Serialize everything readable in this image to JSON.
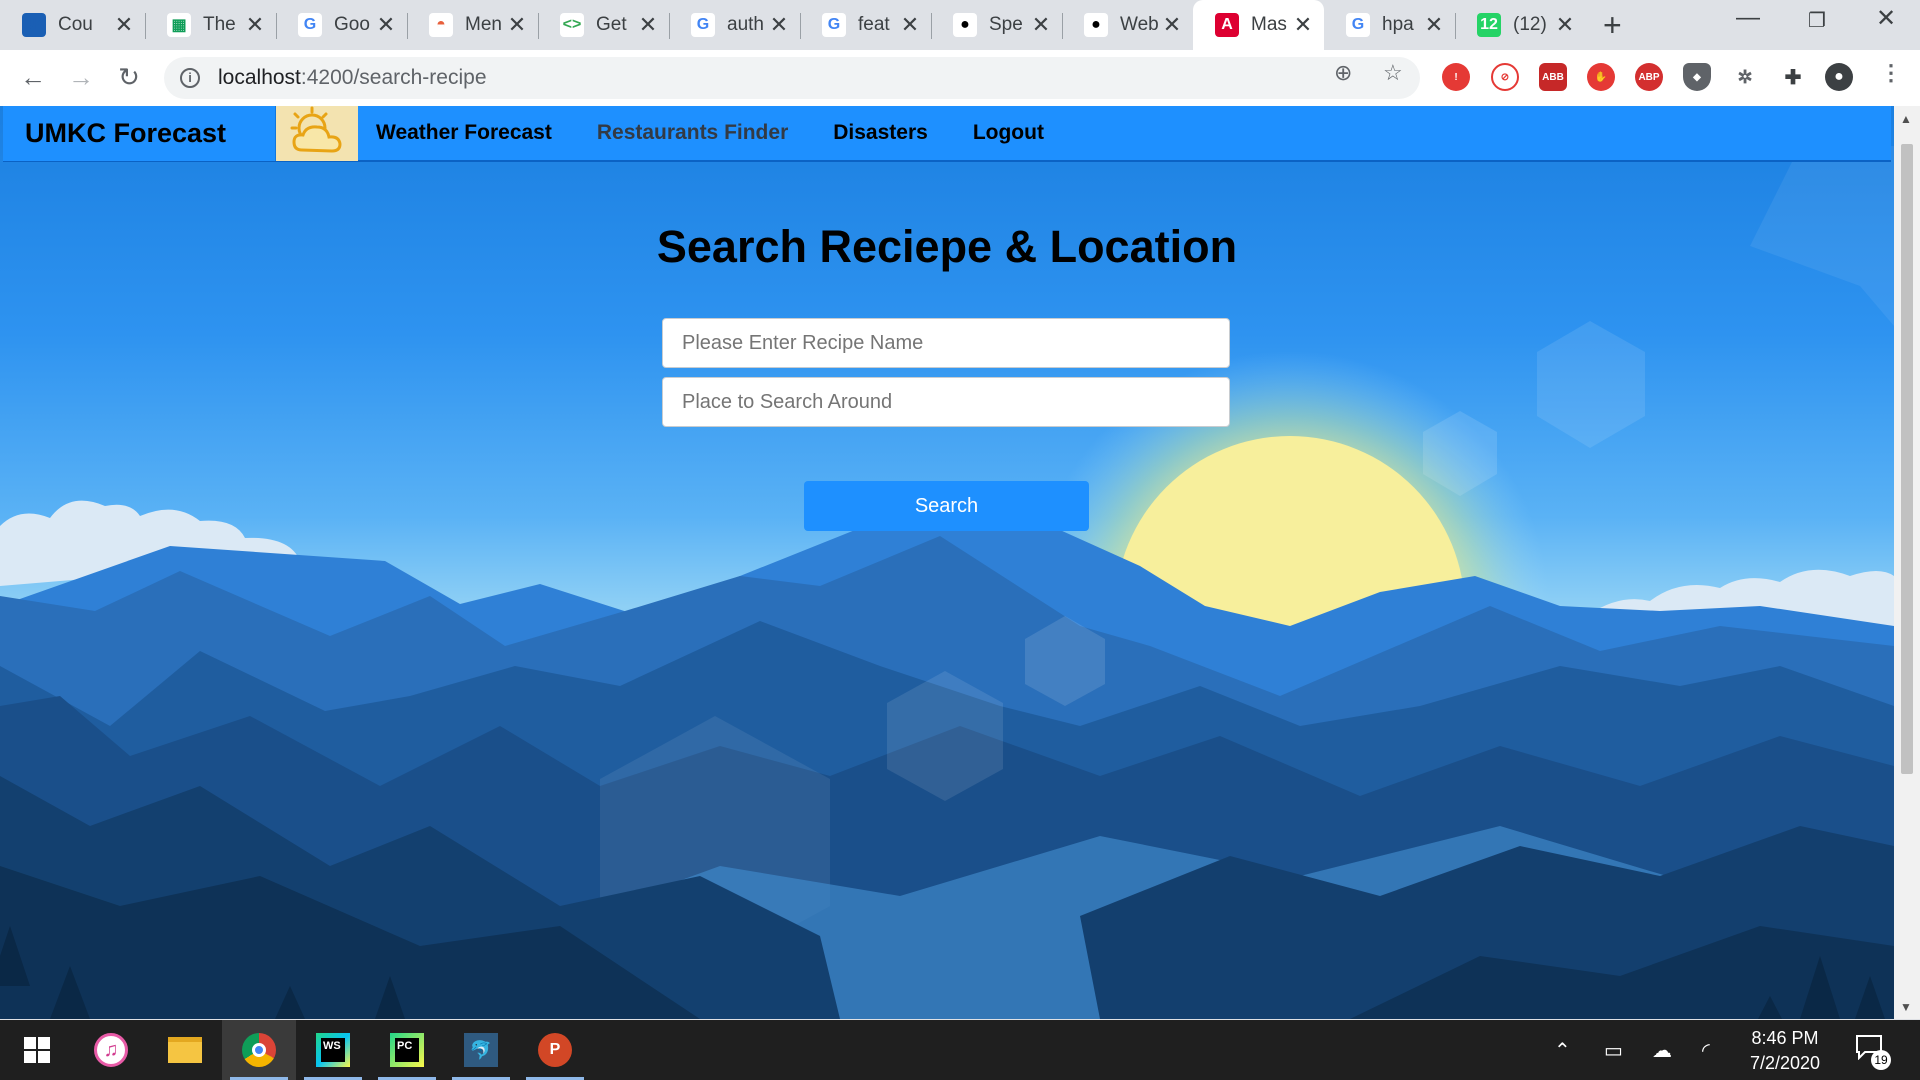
{
  "browser": {
    "tabs": [
      {
        "title": "Cou",
        "favicon": "umkc-icon",
        "fav_text": "UK",
        "fav_color": "#1a5fb4",
        "fav_fg": "#1a5fb4"
      },
      {
        "title": "The",
        "favicon": "sheets-icon",
        "fav_text": "▦",
        "fav_color": "#ffffff",
        "fav_fg": "#0f9d58"
      },
      {
        "title": "Goo",
        "favicon": "google-icon",
        "fav_text": "G",
        "fav_color": "#ffffff",
        "fav_fg": "#4285f4"
      },
      {
        "title": "Men",
        "favicon": "hat-icon",
        "fav_text": "◓",
        "fav_color": "#ffffff",
        "fav_fg": "#e8603c"
      },
      {
        "title": "Get",
        "favicon": "code-icon",
        "fav_text": "<>",
        "fav_color": "#ffffff",
        "fav_fg": "#34a853"
      },
      {
        "title": "auth",
        "favicon": "google-icon",
        "fav_text": "G",
        "fav_color": "#ffffff",
        "fav_fg": "#4285f4"
      },
      {
        "title": "feat",
        "favicon": "google-icon",
        "fav_text": "G",
        "fav_color": "#ffffff",
        "fav_fg": "#4285f4"
      },
      {
        "title": "Spe",
        "favicon": "github-icon",
        "fav_text": "●",
        "fav_color": "#ffffff",
        "fav_fg": "#000000"
      },
      {
        "title": "Web",
        "favicon": "github-icon",
        "fav_text": "●",
        "fav_color": "#ffffff",
        "fav_fg": "#000000"
      },
      {
        "title": "Mas",
        "favicon": "angular-icon",
        "fav_text": "A",
        "fav_color": "#dd0031",
        "fav_fg": "#ffffff",
        "active": true
      },
      {
        "title": "hpa",
        "favicon": "google-icon",
        "fav_text": "G",
        "fav_color": "#ffffff",
        "fav_fg": "#4285f4"
      },
      {
        "title": "(12)",
        "favicon": "whatsapp-icon",
        "fav_text": "12",
        "fav_color": "#25d366",
        "fav_fg": "#ffffff"
      }
    ],
    "tab_close_glyph": "✕",
    "new_tab_glyph": "+",
    "url_host": "localhost",
    "url_rest": ":4200/search-recipe"
  },
  "app": {
    "brand": "UMKC Forecast",
    "logo_icon": "sun-cloud-icon",
    "nav": [
      {
        "label": "Weather Forecast",
        "current": false
      },
      {
        "label": "Restaurants Finder",
        "current": true
      },
      {
        "label": "Disasters",
        "current": false
      },
      {
        "label": "Logout",
        "current": false
      }
    ],
    "form": {
      "title": "Search Reciepe & Location",
      "recipe_placeholder": "Please Enter Recipe Name",
      "place_placeholder": "Place to Search Around",
      "search_label": "Search"
    },
    "colors": {
      "primary": "#1e90ff",
      "sky": "#2e93f0",
      "sun": "#f6ee9a"
    }
  },
  "taskbar": {
    "time": "8:46 PM",
    "date": "7/2/2020",
    "notification_count": "19"
  }
}
